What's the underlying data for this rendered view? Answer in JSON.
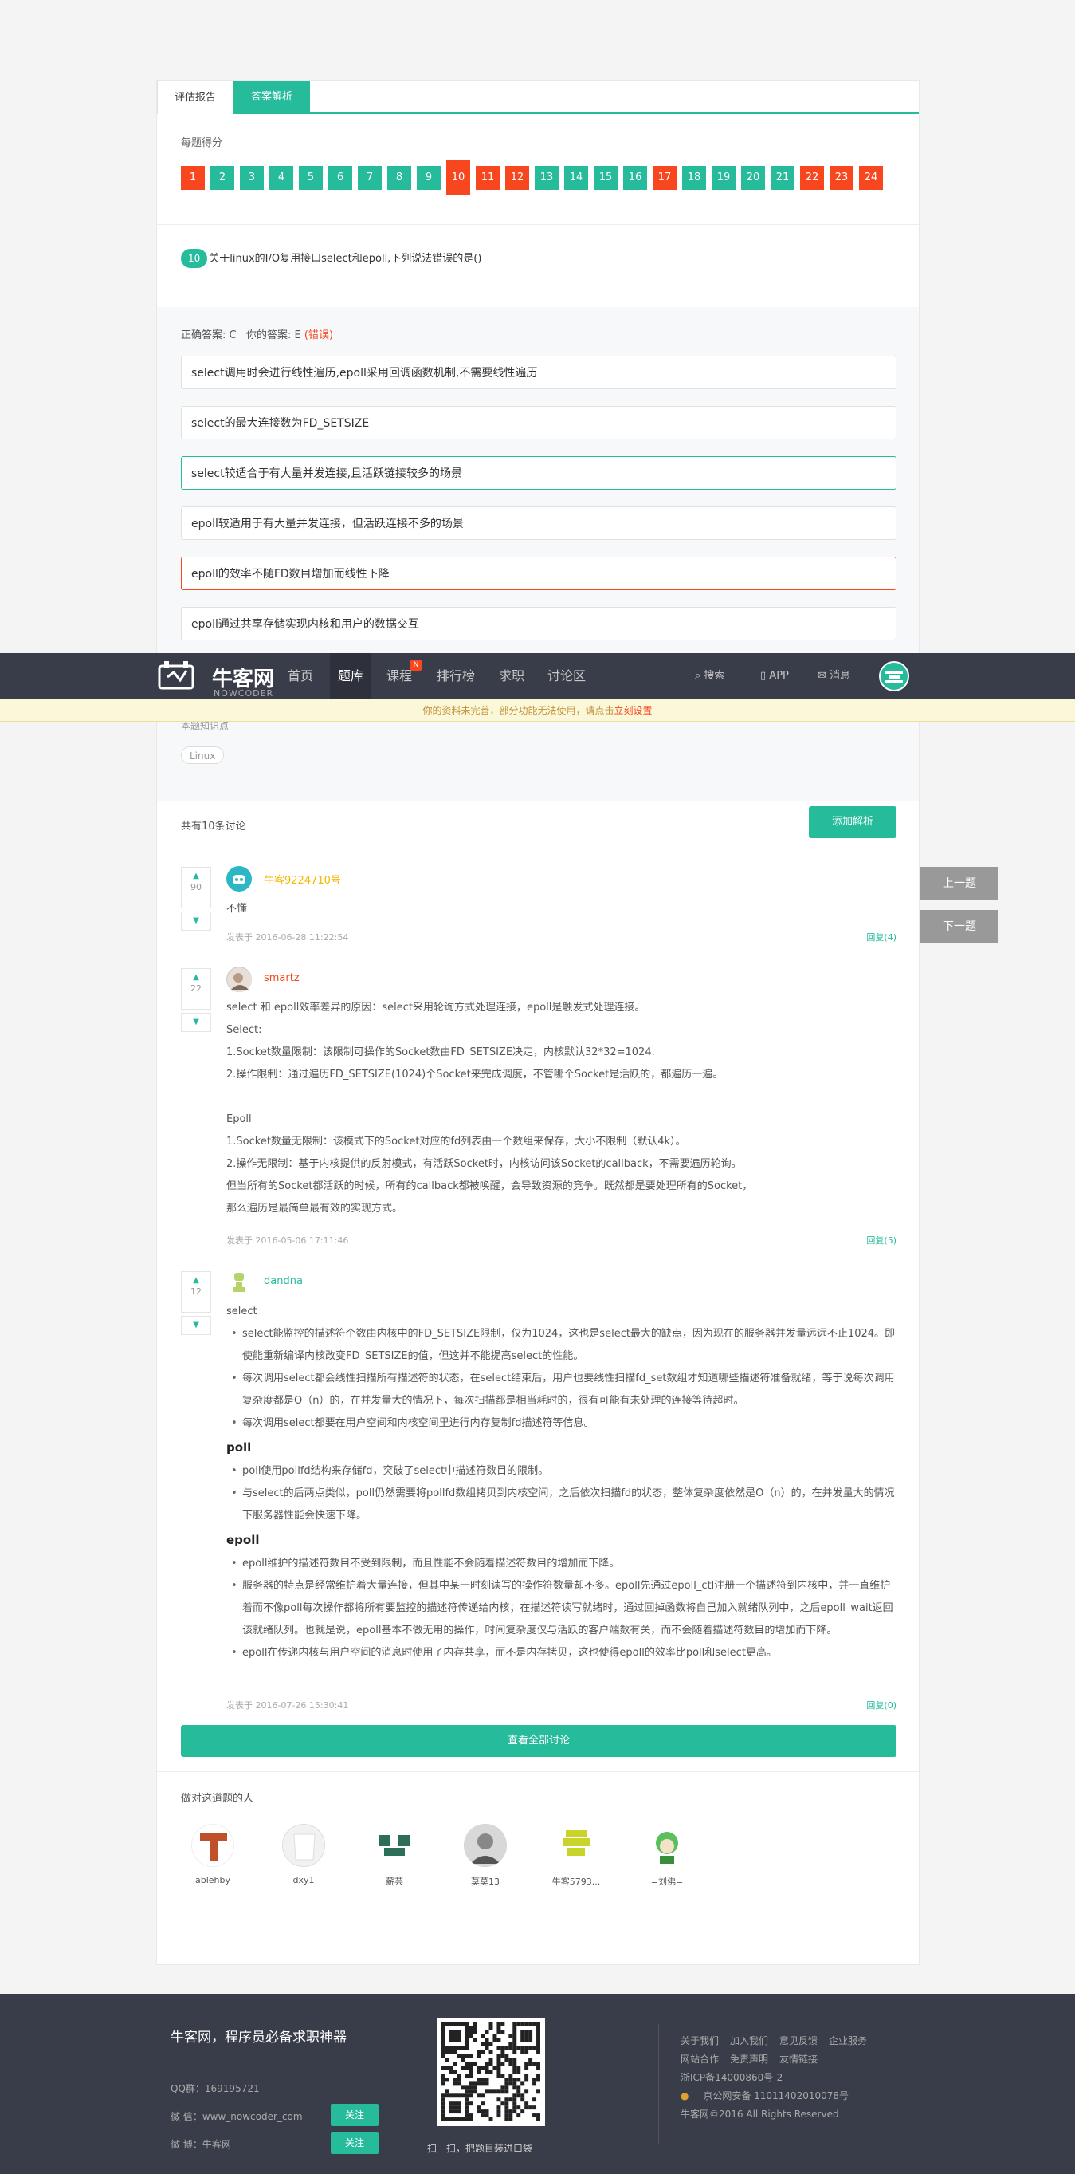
{
  "tabs": [
    "评估报告",
    "答案解析"
  ],
  "score_title": "每题得分",
  "scores": [
    {
      "n": "1",
      "s": "wrong"
    },
    {
      "n": "2",
      "s": "right"
    },
    {
      "n": "3",
      "s": "right"
    },
    {
      "n": "4",
      "s": "right"
    },
    {
      "n": "5",
      "s": "right"
    },
    {
      "n": "6",
      "s": "right"
    },
    {
      "n": "7",
      "s": "right"
    },
    {
      "n": "8",
      "s": "right"
    },
    {
      "n": "9",
      "s": "right"
    },
    {
      "n": "10",
      "s": "current"
    },
    {
      "n": "11",
      "s": "wrong"
    },
    {
      "n": "12",
      "s": "wrong"
    },
    {
      "n": "13",
      "s": "right"
    },
    {
      "n": "14",
      "s": "right"
    },
    {
      "n": "15",
      "s": "right"
    },
    {
      "n": "16",
      "s": "right"
    },
    {
      "n": "17",
      "s": "wrong"
    },
    {
      "n": "18",
      "s": "right"
    },
    {
      "n": "19",
      "s": "right"
    },
    {
      "n": "20",
      "s": "right"
    },
    {
      "n": "21",
      "s": "right"
    },
    {
      "n": "22",
      "s": "wrong"
    },
    {
      "n": "23",
      "s": "wrong"
    },
    {
      "n": "24",
      "s": "wrong"
    }
  ],
  "question": {
    "num": "10",
    "text": "关于linux的I/O复用接口select和epoll,下列说法错误的是()"
  },
  "answer": {
    "correct_label": "正确答案: C",
    "yours_label": "你的答案: E",
    "wrong_tag": "(错误)"
  },
  "options": [
    "select调用时会进行线性遍历,epoll采用回调函数机制,不需要线性遍历",
    "select的最大连接数为FD_SETSIZE",
    "select较适合于有大量并发连接,且活跃链接较多的场景",
    "epoll较适用于有大量并发连接，但活跃连接不多的场景",
    "epoll的效率不随FD数目增加而线性下降",
    "epoll通过共享存储实现内核和用户的数据交互"
  ],
  "note": "本题知识点",
  "tag": "Linux",
  "nav": {
    "brand": "牛客网",
    "brand_sub": "NOWCODER",
    "items": [
      "首页",
      "题库",
      "课程",
      "排行榜",
      "求职",
      "讨论区"
    ],
    "new_badge": "N",
    "search": "搜索",
    "app": "APP",
    "msg": "消息"
  },
  "warning": {
    "text": "你的资料未完善，部分功能无法使用，请点击",
    "link": "立刻设置"
  },
  "discussion": {
    "count_text": "共有10条讨论",
    "add_btn": "添加解析"
  },
  "comments": [
    {
      "votes": "90",
      "user": "牛客9224710号",
      "text": "不懂",
      "date": "发表于 2016-06-28 11:22:54",
      "reply": "回复(4)"
    },
    {
      "votes": "22",
      "user": "smartz",
      "lines": [
        "select 和 epoll效率差异的原因：select采用轮询方式处理连接，epoll是触发式处理连接。",
        "Select:",
        "1.Socket数量限制：该限制可操作的Socket数由FD_SETSIZE决定，内核默认32*32=1024.",
        "2.操作限制：通过遍历FD_SETSIZE(1024)个Socket来完成调度，不管哪个Socket是活跃的，都遍历一遍。",
        "",
        "Epoll",
        "1.Socket数量无限制：该模式下的Socket对应的fd列表由一个数组来保存，大小不限制（默认4k）。",
        "2.操作无限制：基于内核提供的反射模式，有活跃Socket时，内核访问该Socket的callback，不需要遍历轮询。",
        "但当所有的Socket都活跃的时候，所有的callback都被唤醒，会导致资源的竞争。既然都是要处理所有的Socket，",
        "那么遍历是最简单最有效的实现方式。"
      ],
      "date": "发表于 2016-05-06 17:11:46",
      "reply": "回复(5)"
    },
    {
      "votes": "12",
      "user": "dandna",
      "intro": "select",
      "select_items": [
        "select能监控的描述符个数由内核中的FD_SETSIZE限制，仅为1024，这也是select最大的缺点，因为现在的服务器并发量远远不止1024。即使能重新编译内核改变FD_SETSIZE的值，但这并不能提高select的性能。",
        "每次调用select都会线性扫描所有描述符的状态，在select结束后，用户也要线性扫描fd_set数组才知道哪些描述符准备就绪，等于说每次调用复杂度都是O（n）的，在并发量大的情况下，每次扫描都是相当耗时的，很有可能有未处理的连接等待超时。",
        "每次调用select都要在用户空间和内核空间里进行内存复制fd描述符等信息。"
      ],
      "poll_title": "poll",
      "poll_items": [
        "poll使用pollfd结构来存储fd，突破了select中描述符数目的限制。",
        "与select的后两点类似，poll仍然需要将pollfd数组拷贝到内核空间，之后依次扫描fd的状态，整体复杂度依然是O（n）的，在并发量大的情况下服务器性能会快速下降。"
      ],
      "epoll_title": "epoll",
      "epoll_items": [
        "epoll维护的描述符数目不受到限制，而且性能不会随着描述符数目的增加而下降。",
        "服务器的特点是经常维护着大量连接，但其中某一时刻读写的操作符数量却不多。epoll先通过epoll_ctl注册一个描述符到内核中，并一直维护着而不像poll每次操作都将所有要监控的描述符传递给内核；在描述符读写就绪时，通过回掉函数将自己加入就绪队列中，之后epoll_wait返回该就绪队列。也就是说，epoll基本不做无用的操作，时间复杂度仅与活跃的客户端数有关，而不会随着描述符数目的增加而下降。",
        "epoll在传递内核与用户空间的消息时使用了内存共享，而不是内存拷贝，这也使得epoll的效率比poll和select更高。"
      ],
      "date": "发表于 2016-07-26 15:30:41",
      "reply": "回复(0)"
    }
  ],
  "view_all": "查看全部讨论",
  "who_did": "做对这道题的人",
  "people": [
    "ablehby",
    "dxy1",
    "薪芸",
    "莫莫13",
    "牛客5793...",
    "=刘佛="
  ],
  "side": {
    "prev": "上一题",
    "next": "下一题"
  },
  "footer": {
    "title": "牛客网，程序员必备求职神器",
    "qq": "QQ群：169195721",
    "wechat": "微 信：www_nowcoder_com",
    "weibo": "微 博：牛客网",
    "follow": "关注",
    "qr_caption": "扫一扫，把题目装进口袋",
    "links_row1": [
      "关于我们",
      "加入我们",
      "意见反馈",
      "企业服务"
    ],
    "links_row2": [
      "网站合作",
      "免责声明",
      "友情链接"
    ],
    "icp": "浙ICP备14000860号-2",
    "police": "京公网安备 11011402010078号",
    "copyright": "牛客网©2016 All Rights Reserved"
  },
  "colors": {
    "accent": "#25bb9b",
    "wrong": "#f8461f",
    "nav": "#393d49"
  }
}
